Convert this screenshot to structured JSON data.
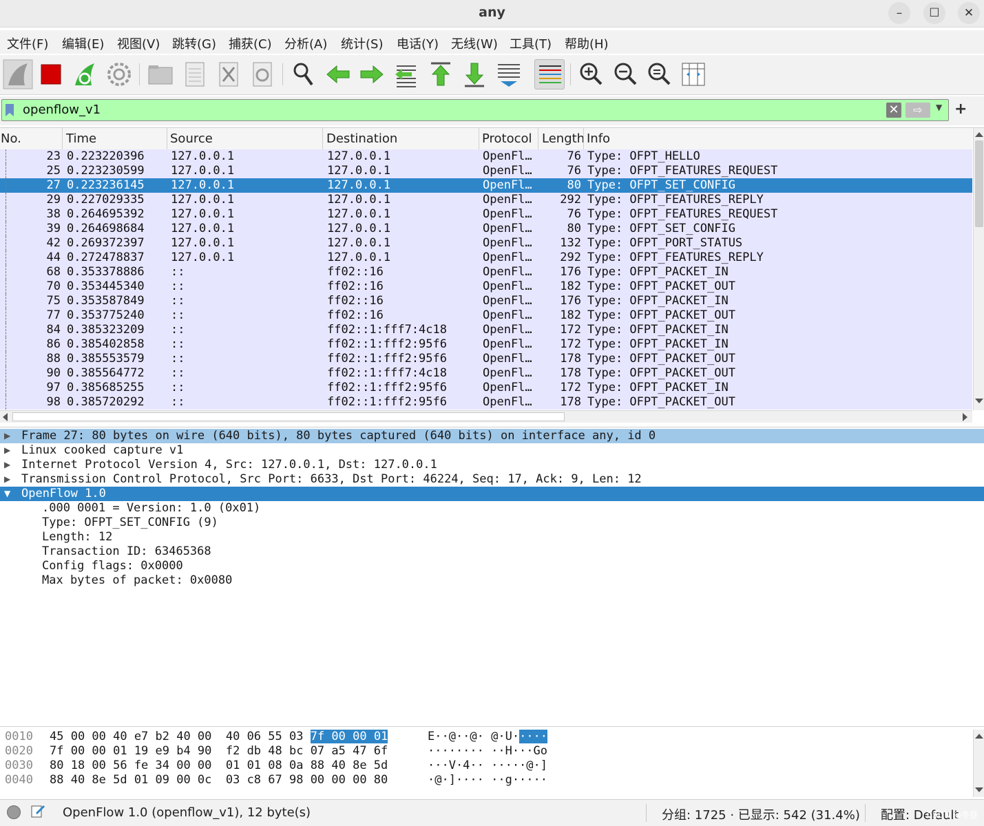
{
  "window": {
    "title": "any",
    "minimize": "–",
    "maximize": "☐",
    "close": "✕"
  },
  "menu": [
    "文件(F)",
    "编辑(E)",
    "视图(V)",
    "跳转(G)",
    "捕获(C)",
    "分析(A)",
    "统计(S)",
    "电话(Y)",
    "无线(W)",
    "工具(T)",
    "帮助(H)"
  ],
  "toolbar": {
    "buttons": [
      "start-capture",
      "stop-capture",
      "restart-capture",
      "capture-options",
      "open-file",
      "save-file",
      "close-file",
      "reload-file",
      "find-packet",
      "go-back",
      "go-forward",
      "go-to-packet",
      "go-first",
      "go-last",
      "auto-scroll",
      "colorize",
      "zoom-in",
      "zoom-out",
      "zoom-normal",
      "resize-columns"
    ],
    "colors": {
      "stop": "#d40000",
      "green": "#3bb33b",
      "gray": "#9a9a9a"
    }
  },
  "filter": {
    "value": "openflow_v1",
    "clear": "✕",
    "apply": "⇨",
    "add": "+",
    "bg_color": "#afffaf"
  },
  "packet_list": {
    "columns": [
      "No.",
      "Time",
      "Source",
      "Destination",
      "Protocol",
      "Length",
      "Info"
    ],
    "rows": [
      {
        "no": "23",
        "time": "0.223220396",
        "src": "127.0.0.1",
        "dst": "127.0.0.1",
        "proto": "OpenFl…",
        "len": "76",
        "info": "Type: OFPT_HELLO"
      },
      {
        "no": "25",
        "time": "0.223230599",
        "src": "127.0.0.1",
        "dst": "127.0.0.1",
        "proto": "OpenFl…",
        "len": "76",
        "info": "Type: OFPT_FEATURES_REQUEST"
      },
      {
        "no": "27",
        "time": "0.223236145",
        "src": "127.0.0.1",
        "dst": "127.0.0.1",
        "proto": "OpenFl…",
        "len": "80",
        "info": "Type: OFPT_SET_CONFIG",
        "selected": true
      },
      {
        "no": "29",
        "time": "0.227029335",
        "src": "127.0.0.1",
        "dst": "127.0.0.1",
        "proto": "OpenFl…",
        "len": "292",
        "info": "Type: OFPT_FEATURES_REPLY"
      },
      {
        "no": "38",
        "time": "0.264695392",
        "src": "127.0.0.1",
        "dst": "127.0.0.1",
        "proto": "OpenFl…",
        "len": "76",
        "info": "Type: OFPT_FEATURES_REQUEST"
      },
      {
        "no": "39",
        "time": "0.264698684",
        "src": "127.0.0.1",
        "dst": "127.0.0.1",
        "proto": "OpenFl…",
        "len": "80",
        "info": "Type: OFPT_SET_CONFIG"
      },
      {
        "no": "42",
        "time": "0.269372397",
        "src": "127.0.0.1",
        "dst": "127.0.0.1",
        "proto": "OpenFl…",
        "len": "132",
        "info": "Type: OFPT_PORT_STATUS"
      },
      {
        "no": "44",
        "time": "0.272478837",
        "src": "127.0.0.1",
        "dst": "127.0.0.1",
        "proto": "OpenFl…",
        "len": "292",
        "info": "Type: OFPT_FEATURES_REPLY"
      },
      {
        "no": "68",
        "time": "0.353378886",
        "src": "::",
        "dst": "ff02::16",
        "proto": "OpenFl…",
        "len": "176",
        "info": "Type: OFPT_PACKET_IN"
      },
      {
        "no": "70",
        "time": "0.353445340",
        "src": "::",
        "dst": "ff02::16",
        "proto": "OpenFl…",
        "len": "182",
        "info": "Type: OFPT_PACKET_OUT"
      },
      {
        "no": "75",
        "time": "0.353587849",
        "src": "::",
        "dst": "ff02::16",
        "proto": "OpenFl…",
        "len": "176",
        "info": "Type: OFPT_PACKET_IN"
      },
      {
        "no": "77",
        "time": "0.353775240",
        "src": "::",
        "dst": "ff02::16",
        "proto": "OpenFl…",
        "len": "182",
        "info": "Type: OFPT_PACKET_OUT"
      },
      {
        "no": "84",
        "time": "0.385323209",
        "src": "::",
        "dst": "ff02::1:fff7:4c18",
        "proto": "OpenFl…",
        "len": "172",
        "info": "Type: OFPT_PACKET_IN"
      },
      {
        "no": "86",
        "time": "0.385402858",
        "src": "::",
        "dst": "ff02::1:fff2:95f6",
        "proto": "OpenFl…",
        "len": "172",
        "info": "Type: OFPT_PACKET_IN"
      },
      {
        "no": "88",
        "time": "0.385553579",
        "src": "::",
        "dst": "ff02::1:fff2:95f6",
        "proto": "OpenFl…",
        "len": "178",
        "info": "Type: OFPT_PACKET_OUT"
      },
      {
        "no": "90",
        "time": "0.385564772",
        "src": "::",
        "dst": "ff02::1:fff7:4c18",
        "proto": "OpenFl…",
        "len": "178",
        "info": "Type: OFPT_PACKET_OUT"
      },
      {
        "no": "97",
        "time": "0.385685255",
        "src": "::",
        "dst": "ff02::1:fff2:95f6",
        "proto": "OpenFl…",
        "len": "172",
        "info": "Type: OFPT_PACKET_IN"
      },
      {
        "no": "98",
        "time": "0.385720292",
        "src": "::",
        "dst": "ff02::1:fff2:95f6",
        "proto": "OpenFl…",
        "len": "178",
        "info": "Type: OFPT_PACKET_OUT"
      }
    ],
    "row_color": "#e7e6ff",
    "selected_color": "#2e86c9"
  },
  "details": [
    {
      "text": "Frame 27: 80 bytes on wire (640 bits), 80 bytes captured (640 bits) on interface any, id 0",
      "expander": "▶",
      "state": "hl"
    },
    {
      "text": "Linux cooked capture v1",
      "expander": "▶"
    },
    {
      "text": "Internet Protocol Version 4, Src: 127.0.0.1, Dst: 127.0.0.1",
      "expander": "▶"
    },
    {
      "text": "Transmission Control Protocol, Src Port: 6633, Dst Port: 46224, Seq: 17, Ack: 9, Len: 12",
      "expander": "▶"
    },
    {
      "text": "OpenFlow 1.0",
      "expander": "▼",
      "state": "sel"
    },
    {
      "text": ".000 0001 = Version: 1.0 (0x01)",
      "child": true
    },
    {
      "text": "Type: OFPT_SET_CONFIG (9)",
      "child": true
    },
    {
      "text": "Length: 12",
      "child": true
    },
    {
      "text": "Transaction ID: 63465368",
      "child": true
    },
    {
      "text": "Config flags: 0x0000",
      "child": true
    },
    {
      "text": "Max bytes of packet: 0x0080",
      "child": true
    }
  ],
  "bytes": [
    {
      "offset": "0010",
      "hex": "45 00 00 40 e7 b2 40 00  40 06 55 03 ",
      "hex_sel": "7f 00 00 01",
      "ascii": "E··@··@· @·U·",
      "ascii_sel": "····"
    },
    {
      "offset": "0020",
      "hex": "7f 00 00 01 19 e9 b4 90  f2 db 48 bc 07 a5 47 6f",
      "hex_sel": "",
      "ascii": "········ ··H···Go",
      "ascii_sel": ""
    },
    {
      "offset": "0030",
      "hex": "80 18 00 56 fe 34 00 00  01 01 08 0a 88 40 8e 5d",
      "hex_sel": "",
      "ascii": "···V·4·· ·····@·]",
      "ascii_sel": ""
    },
    {
      "offset": "0040",
      "hex": "88 40 8e 5d 01 09 00 0c  03 c8 67 98 00 00 00 80",
      "hex_sel": "",
      "ascii": "·@·]···· ··g·····",
      "ascii_sel": ""
    }
  ],
  "status": {
    "protocol_info": "OpenFlow 1.0 (openflow_v1), 12 byte(s)",
    "packets": "分组: 1725 · 已显示: 542 (31.4%)",
    "profile": "配置: Default"
  },
  "watermark": "CSDN @冬昼"
}
